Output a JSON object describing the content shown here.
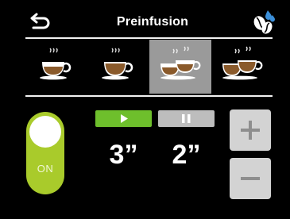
{
  "header": {
    "title": "Preinfusion",
    "back_icon": "back-arrow-icon",
    "beans_icon": "coffee-beans-water-icon"
  },
  "cups": [
    {
      "name": "single-cup",
      "selected": false
    },
    {
      "name": "single-cup-large",
      "selected": false
    },
    {
      "name": "double-cup",
      "selected": true
    },
    {
      "name": "double-cup-large",
      "selected": false
    }
  ],
  "toggle": {
    "label": "ON",
    "state": "on"
  },
  "phases": {
    "play_time": "3”",
    "pause_time": "2”"
  },
  "colors": {
    "background": "#000000",
    "accent_green": "#a9cb2b",
    "play_green": "#6ebf2c",
    "neutral_grey": "#bdbdbd",
    "selected_cup": "#9a9a9a",
    "coffee": "#8a5a2b"
  }
}
